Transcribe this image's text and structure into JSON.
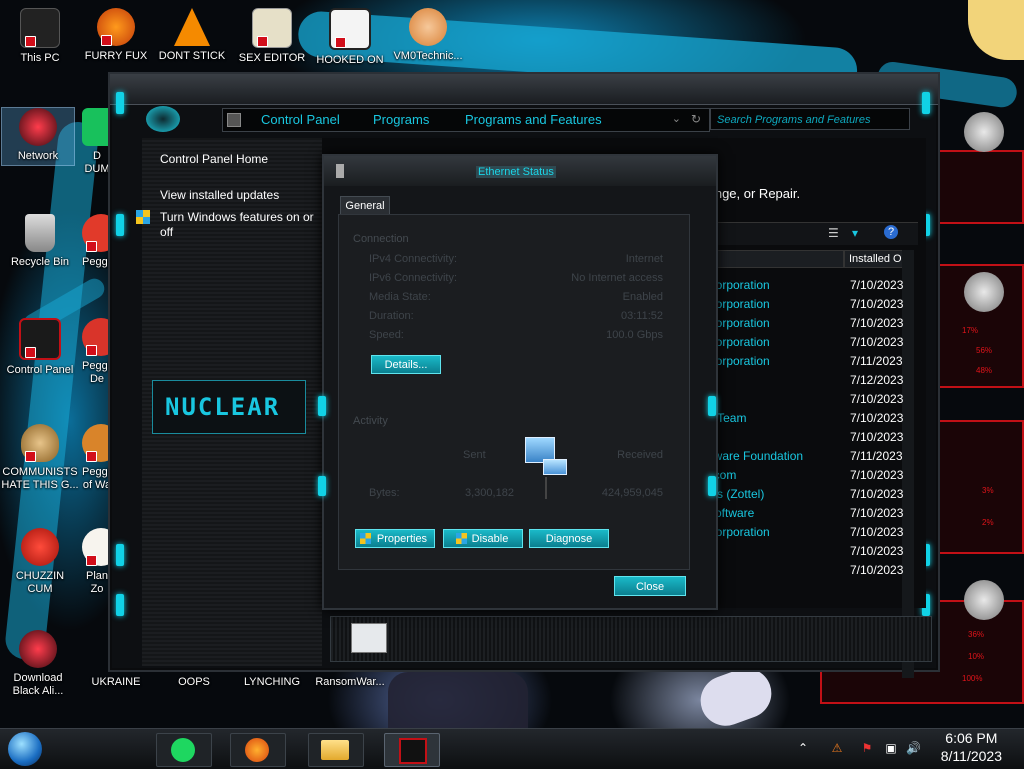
{
  "desktop_icons": [
    {
      "label": "This PC"
    },
    {
      "label": "FURRY FUX"
    },
    {
      "label": "DONT STICK"
    },
    {
      "label": "SEX EDITOR"
    },
    {
      "label": "HOOKED ON"
    },
    {
      "label": "VM0Technic..."
    },
    {
      "label": "Network"
    },
    {
      "label": "D DUM"
    },
    {
      "label": "Recycle Bin"
    },
    {
      "label": "Peggle"
    },
    {
      "label": "Control Panel"
    },
    {
      "label": "Peggle De"
    },
    {
      "label": "COMMUNISTS HATE THIS G..."
    },
    {
      "label": "Peggle of Wa"
    },
    {
      "label": "CHUZZIN CUM"
    },
    {
      "label": "Plan Zo"
    },
    {
      "label": "Download Black Ali..."
    },
    {
      "label": "UKRAINE"
    },
    {
      "label": "OOPS"
    },
    {
      "label": "LYNCHING"
    },
    {
      "label": "RansomWar..."
    }
  ],
  "explorer": {
    "breadcrumb": [
      "Control Panel",
      "Programs",
      "Programs and Features"
    ],
    "search_placeholder": "Search Programs and Features",
    "left_links": [
      "Control Panel Home",
      "View installed updates",
      "Turn Windows features on or off"
    ],
    "logo_text": "NUCLEAR",
    "header_text": "ll, Change, or Repair.",
    "column_installed": "Installed O",
    "publishers": [
      "Corporation",
      "Corporation",
      "Corporation",
      "Corporation",
      "Corporation",
      "",
      "",
      "+ Team",
      "",
      "ftware Foundation",
      "t.com",
      "efs (Zottel)",
      "Software",
      "Corporation",
      "",
      ""
    ],
    "dates": [
      "7/10/2023",
      "7/10/2023",
      "7/10/2023",
      "7/10/2023",
      "7/11/2023",
      "7/12/2023",
      "7/10/2023",
      "7/10/2023",
      "7/10/2023",
      "7/11/2023",
      "7/10/2023",
      "7/10/2023",
      "7/10/2023",
      "7/10/2023",
      "7/10/2023",
      "7/10/2023"
    ]
  },
  "dialog": {
    "title": "Ethernet Status",
    "tab": "General",
    "connection_label": "Connection",
    "rows": [
      {
        "label": "IPv4 Connectivity:",
        "value": "Internet"
      },
      {
        "label": "IPv6 Connectivity:",
        "value": "No Internet access"
      },
      {
        "label": "Media State:",
        "value": "Enabled"
      },
      {
        "label": "Duration:",
        "value": "03:11:52"
      },
      {
        "label": "Speed:",
        "value": "100.0 Gbps"
      }
    ],
    "details_button": "Details...",
    "activity_label": "Activity",
    "sent_label": "Sent",
    "received_label": "Received",
    "bytes_label": "Bytes:",
    "bytes_sent": "3,300,182",
    "bytes_received": "424,959,045",
    "properties_button": "Properties",
    "disable_button": "Disable",
    "diagnose_button": "Diagnose",
    "close_button": "Close"
  },
  "taskbar": {
    "time": "6:06 PM",
    "date": "8/11/2023"
  },
  "sidebar_gauge_values": [
    "17%",
    "56%",
    "48%",
    "3%",
    "2%",
    "36%",
    "10%",
    "100%"
  ],
  "colors": {
    "accent": "#19c7e0",
    "frame": "#2b3036",
    "alert": "#c21016"
  }
}
